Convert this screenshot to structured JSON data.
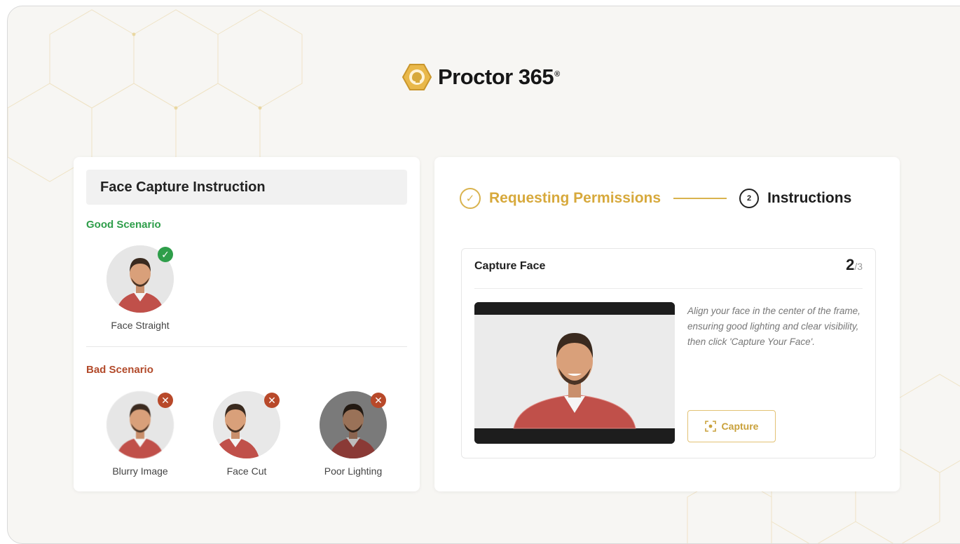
{
  "brand": {
    "name": "Proctor 365",
    "registered": "®",
    "accent": "#d7a93c"
  },
  "left_panel": {
    "title": "Face Capture Instruction",
    "good_label": "Good Scenario",
    "bad_label": "Bad Scenario",
    "good_items": [
      {
        "caption": "Face Straight",
        "badge": "check-icon"
      }
    ],
    "bad_items": [
      {
        "caption": "Blurry Image",
        "badge": "x-icon"
      },
      {
        "caption": "Face Cut",
        "badge": "x-icon"
      },
      {
        "caption": "Poor Lighting",
        "badge": "x-icon"
      }
    ],
    "colors": {
      "good": "#2e9e4a",
      "bad": "#b24a2a"
    }
  },
  "stepper": {
    "step1": {
      "label": "Requesting Permissions",
      "status": "complete"
    },
    "step2": {
      "number": "2",
      "label": "Instructions",
      "status": "current"
    }
  },
  "capture": {
    "title": "Capture Face",
    "current": "2",
    "total": "/3",
    "instruction": "Align your face in the center of the frame, ensuring good lighting and clear visibility, then click 'Capture Your Face'.",
    "button_label": "Capture"
  }
}
